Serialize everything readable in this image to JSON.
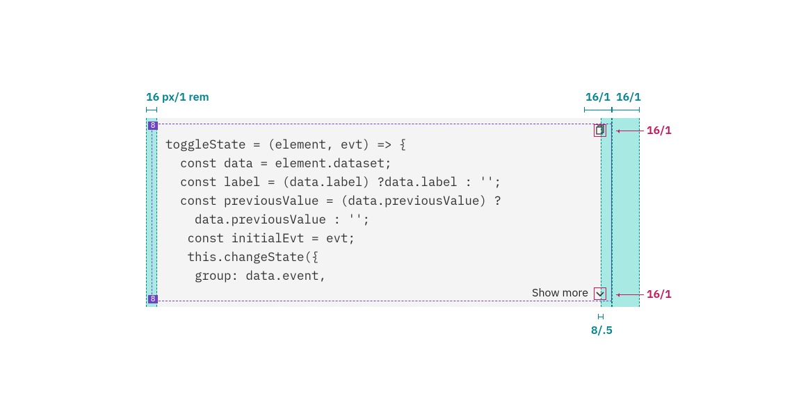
{
  "spec": {
    "left_label": "16 px/1 rem",
    "top_r1": "16/1",
    "top_r2": "16/1",
    "right_copy": "16/1",
    "right_chev": "16/1",
    "bottom_gap": "8/.5",
    "badge": "8"
  },
  "code": {
    "lines": [
      "toggleState = (element, evt) => {",
      "  const data = element.dataset;",
      "  const label = (data.label) ?data.label : '';",
      "  const previousValue = (data.previousValue) ?",
      "    data.previousValue : '';",
      "   const initialEvt = evt;",
      "   this.changeState({",
      "    group: data.event,"
    ]
  },
  "controls": {
    "showmore": "Show more"
  }
}
